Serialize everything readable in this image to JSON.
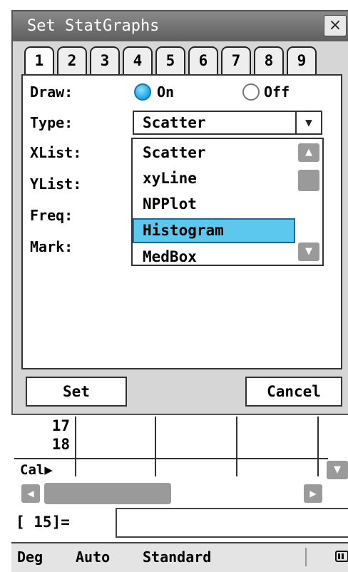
{
  "dialog": {
    "title": "Set StatGraphs",
    "close_icon": "close-icon",
    "tabs": [
      "1",
      "2",
      "3",
      "4",
      "5",
      "6",
      "7",
      "8",
      "9"
    ],
    "active_tab": "1",
    "draw": {
      "label": "Draw:",
      "on_label": "On",
      "off_label": "Off",
      "selected": "On"
    },
    "type": {
      "label": "Type:",
      "value": "Scatter",
      "options": [
        "Scatter",
        "xyLine",
        "NPPlot",
        "Histogram",
        "MedBox"
      ],
      "highlighted": "Histogram"
    },
    "xlist_label": "XList:",
    "ylist_label": "YList:",
    "freq_label": "Freq:",
    "mark_label": "Mark:",
    "set_label": "Set",
    "cancel_label": "Cancel"
  },
  "app": {
    "rows": [
      "17",
      "18"
    ],
    "cal_label": "Cal▶",
    "entry_label": "[ 15]=",
    "entry_value": ""
  },
  "status": {
    "angle": "Deg",
    "mode": "Auto",
    "format": "Standard",
    "battery_icon": "battery-icon"
  },
  "colors": {
    "accent": "#5cc8ee",
    "radio_on": "#1aa6e6",
    "titlebar": "#6e6e6e",
    "scroll_gray": "#9a9a9a"
  }
}
